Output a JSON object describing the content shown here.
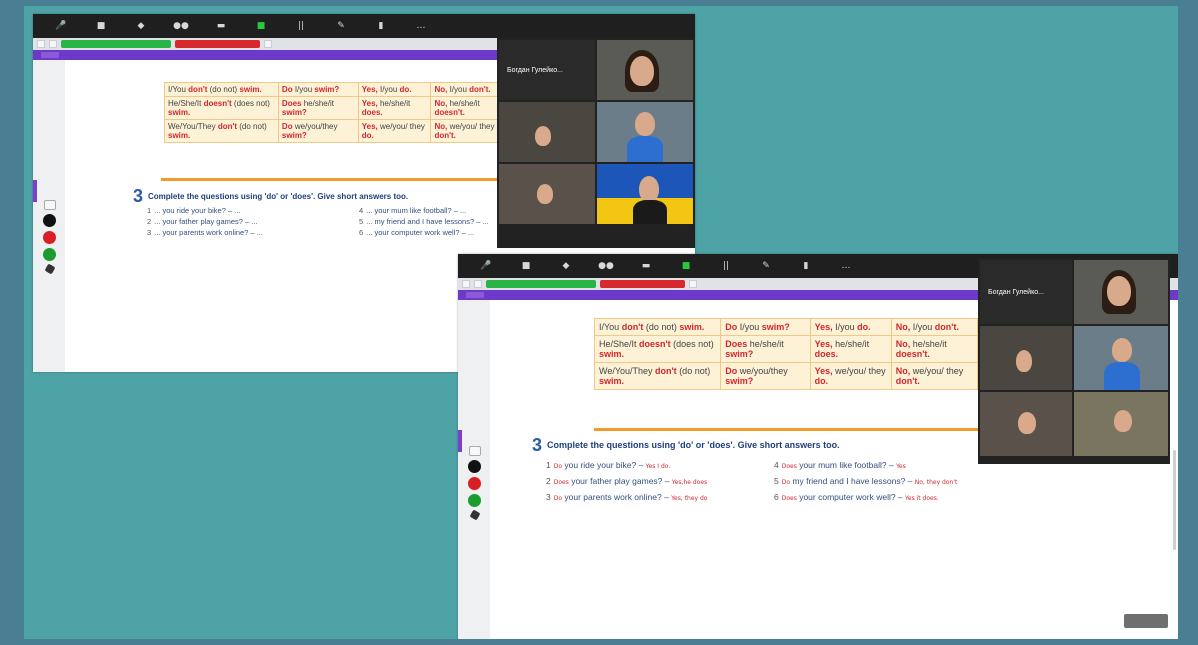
{
  "grammar_table": [
    [
      "I/You ",
      "don't",
      " (do not) ",
      "swim.",
      "Do",
      " I/you ",
      "swim?",
      "Yes,",
      " I/you ",
      "do.",
      "No,",
      " I/you ",
      "don't."
    ],
    [
      "He/She/It ",
      "doesn't",
      " (does not) ",
      "swim.",
      "Does",
      " he/she/it ",
      "swim?",
      "Yes,",
      " he/she/it ",
      "does.",
      "No,",
      " he/she/it ",
      "doesn't."
    ],
    [
      "We/You/They ",
      "don't",
      " (do not) ",
      "swim.",
      "Do",
      " we/you/they ",
      "swim?",
      "Yes,",
      " we/you/ they ",
      "do.",
      "No,",
      " we/you/ they ",
      "don't."
    ]
  ],
  "exercise": {
    "number": "3",
    "instruction": "Complete the questions using 'do' or 'does'. Give short answers too."
  },
  "questions_left": [
    {
      "n": "1",
      "text": "... you ride your bike? – ..."
    },
    {
      "n": "2",
      "text": "... your father play games? – ..."
    },
    {
      "n": "3",
      "text": "... your parents work online? – ..."
    }
  ],
  "questions_right": [
    {
      "n": "4",
      "text": "... your mum like football? – ..."
    },
    {
      "n": "5",
      "text": "... my friend and I have lessons? – ..."
    },
    {
      "n": "6",
      "text": "... your computer work well? – ..."
    }
  ],
  "answered_left": [
    {
      "n": "1",
      "pre": "Do",
      "text": "you ride your bike? – ",
      "ans": "Yes I do."
    },
    {
      "n": "2",
      "pre": "Does",
      "text": "your father play games? – ",
      "ans": "Yes,he does"
    },
    {
      "n": "3",
      "pre": "Do",
      "text": "your parents work online? – ",
      "ans": "Yes, they do"
    }
  ],
  "answered_right": [
    {
      "n": "4",
      "pre": "Does",
      "text": "your mum like football? – ",
      "ans": "Yes"
    },
    {
      "n": "5",
      "pre": "Do",
      "text": "my friend and I have lessons? – ",
      "ans": "No, they don't"
    },
    {
      "n": "6",
      "pre": "Does",
      "text": "your computer work well? – ",
      "ans": "Yes it does."
    }
  ],
  "participant_name": "Богдан Гулейко..."
}
